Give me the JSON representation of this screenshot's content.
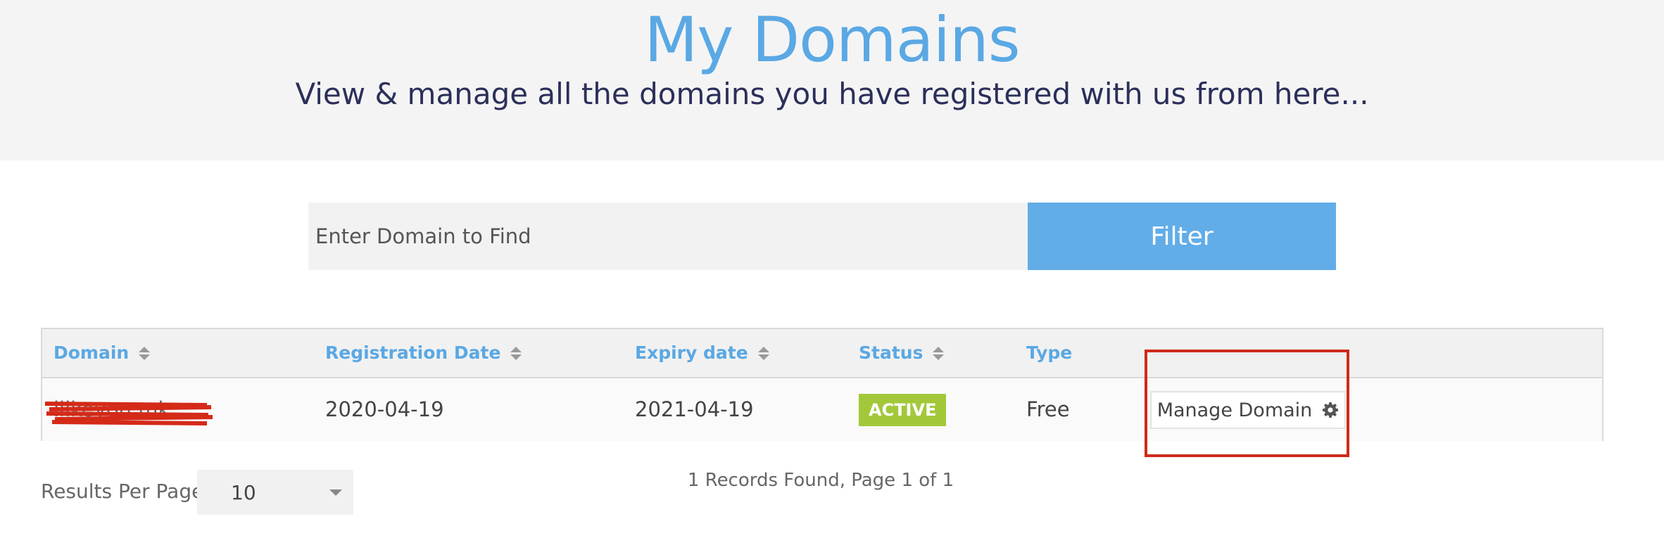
{
  "header": {
    "title": "My Domains",
    "subtitle": "View & manage all the domains you have registered with us from here..."
  },
  "filter": {
    "placeholder": "Enter Domain to Find",
    "button_label": "Filter"
  },
  "table": {
    "columns": [
      "Domain",
      "Registration Date",
      "Expiry date",
      "Status",
      "Type"
    ],
    "rows": [
      {
        "domain": "ilikeyou.mk",
        "registration_date": "2020-04-19",
        "expiry_date": "2021-04-19",
        "status": "ACTIVE",
        "type": "Free",
        "action_label": "Manage Domain"
      }
    ]
  },
  "pagination": {
    "records_text": "1 Records Found, Page 1 of 1",
    "results_per_page_label": "Results Per Page:",
    "results_per_page_value": "10"
  },
  "colors": {
    "accent": "#5aa8e4",
    "filter_button": "#62ade8",
    "status_active": "#a2c83a",
    "highlight": "#cf2a1a",
    "subtitle": "#2b2f5a"
  },
  "icons": [
    "sort-icon",
    "gear-icon",
    "caret-down-icon"
  ]
}
